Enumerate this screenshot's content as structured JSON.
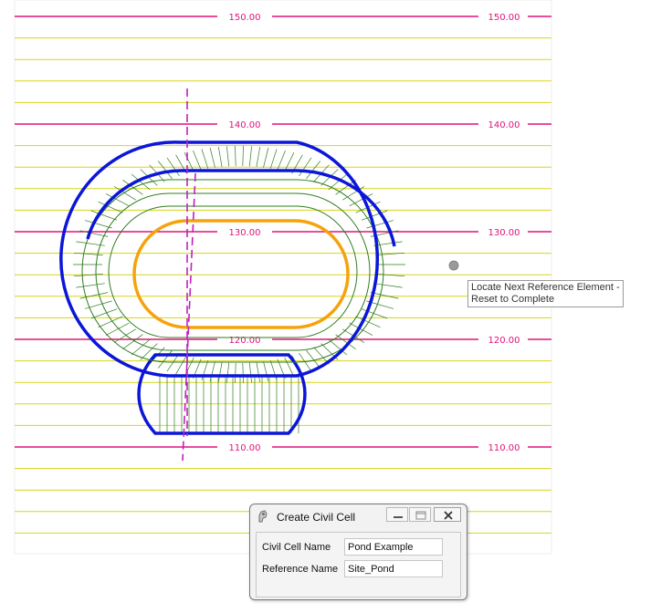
{
  "drawing": {
    "contour_labels": [
      "150.00",
      "140.00",
      "130.00",
      "120.00",
      "110.00"
    ],
    "colors": {
      "grid_line": "#d7d51a",
      "major_contour": "#e0137a",
      "pond_outline": "#0b16d8",
      "inner_contour": "#2f7d1f",
      "pond_bottom": "#f5a30d",
      "reference_line": "#c21fc2",
      "cursor": "#9a9a9a"
    }
  },
  "tooltip": {
    "line1": "Locate Next Reference Element -",
    "line2": "Reset to Complete"
  },
  "dialog": {
    "title": "Create Civil Cell",
    "fields": [
      {
        "label": "Civil Cell Name",
        "value": "Pond Example"
      },
      {
        "label": "Reference Name",
        "value": "Site_Pond"
      }
    ],
    "icons": [
      "minimize-icon",
      "restore-icon",
      "close-icon"
    ]
  }
}
